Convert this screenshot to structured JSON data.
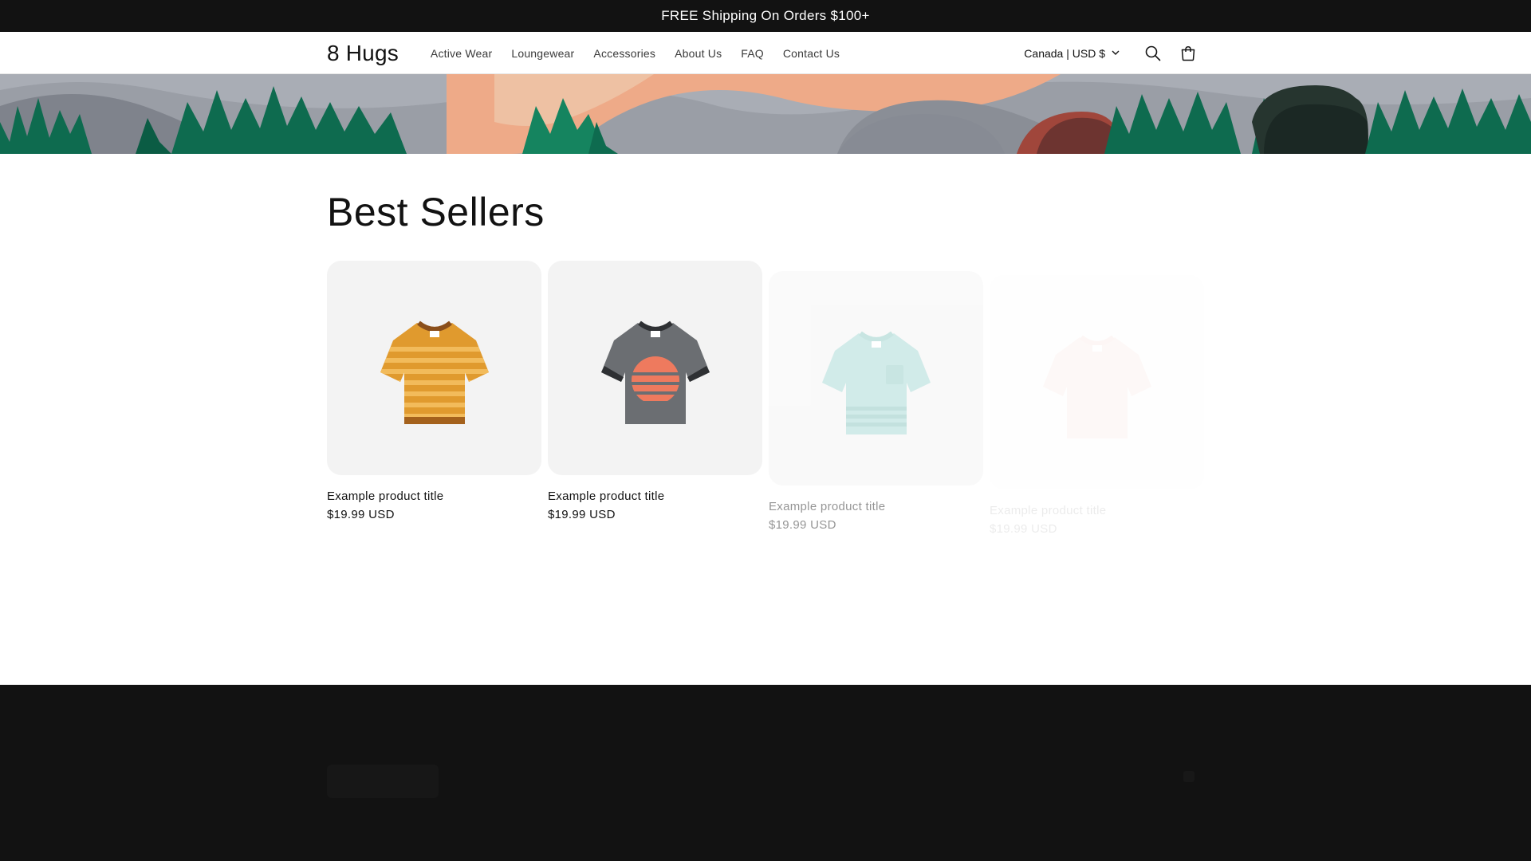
{
  "announcement": {
    "text": "FREE Shipping On Orders $100+"
  },
  "header": {
    "logo": "8 Hugs",
    "nav": [
      {
        "label": "Active Wear"
      },
      {
        "label": "Loungewear"
      },
      {
        "label": "Accessories"
      },
      {
        "label": "About Us"
      },
      {
        "label": "FAQ"
      },
      {
        "label": "Contact Us"
      }
    ],
    "locale": "Canada | USD $",
    "icons": [
      "search-icon",
      "cart-icon",
      "chevron-down-icon"
    ]
  },
  "section": {
    "title": "Best Sellers"
  },
  "products": [
    {
      "title": "Example product title",
      "price": "$19.99 USD",
      "shirt_color": "#e09a2e",
      "opacity": 1
    },
    {
      "title": "Example product title",
      "price": "$19.99 USD",
      "shirt_color": "#6b6e72",
      "opacity": 1
    },
    {
      "title": "Example product title",
      "price": "$19.99 USD",
      "shirt_color": "#9ad4cf",
      "opacity": 0.45
    },
    {
      "title": "Example product title",
      "price": "$19.99 USD",
      "shirt_color": "#f2b5a4",
      "opacity": 0.08
    }
  ],
  "colors": {
    "announcement_bg": "#121212",
    "footer_bg": "#121212",
    "forest_green": "#0e6b4f",
    "peach": "#eeaa88"
  }
}
